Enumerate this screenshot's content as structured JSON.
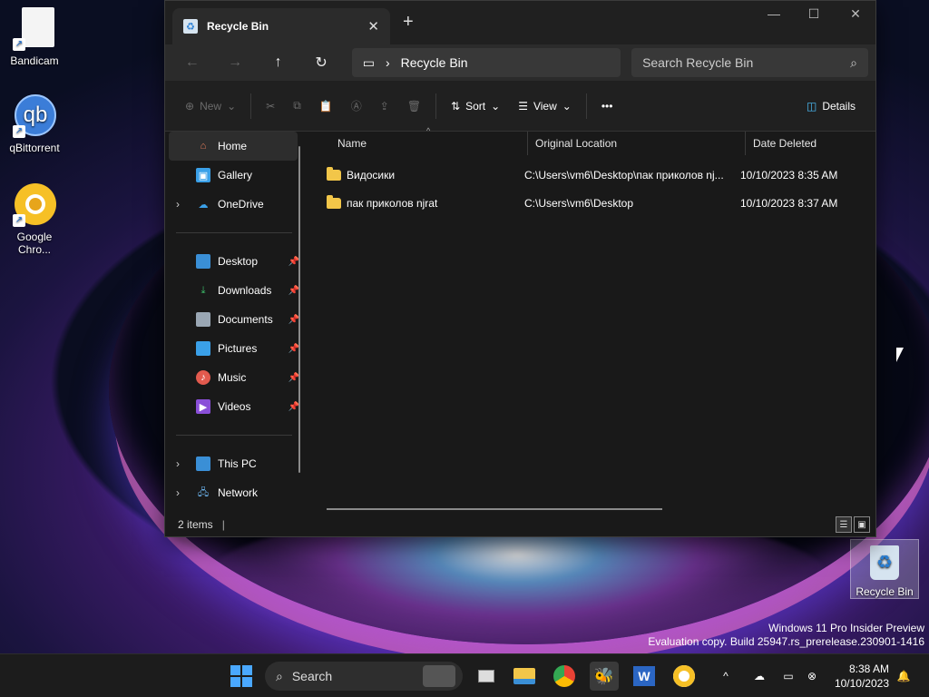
{
  "desktop": {
    "icons": [
      {
        "label": "Bandicam"
      },
      {
        "label": "qBittorrent"
      },
      {
        "label": "Google Chro..."
      },
      {
        "label": "Recycle Bin"
      }
    ],
    "watermark": {
      "line1": "Windows 11 Pro Insider Preview",
      "line2": "Evaluation copy. Build 25947.rs_prerelease.230901-1416"
    }
  },
  "window": {
    "tab_title": "Recycle Bin",
    "address": "Recycle Bin",
    "search_placeholder": "Search Recycle Bin",
    "toolbar": {
      "new_label": "New",
      "sort_label": "Sort",
      "view_label": "View",
      "more_label": "•••",
      "details_label": "Details"
    },
    "nav": {
      "home": "Home",
      "gallery": "Gallery",
      "onedrive": "OneDrive",
      "desktop": "Desktop",
      "downloads": "Downloads",
      "documents": "Documents",
      "pictures": "Pictures",
      "music": "Music",
      "videos": "Videos",
      "this_pc": "This PC",
      "network": "Network"
    },
    "columns": {
      "name": "Name",
      "original_location": "Original Location",
      "date_deleted": "Date Deleted"
    },
    "files": [
      {
        "name": "Видосики",
        "location": "C:\\Users\\vm6\\Desktop\\пак приколов nj...",
        "date": "10/10/2023 8:35 AM"
      },
      {
        "name": "пак приколов njrat",
        "location": "C:\\Users\\vm6\\Desktop",
        "date": "10/10/2023 8:37 AM"
      }
    ],
    "status": "2 items"
  },
  "taskbar": {
    "search_label": "Search",
    "time": "8:38 AM",
    "date": "10/10/2023"
  },
  "colors": {
    "accent": "#4cc2ff",
    "folder": "#f2c649",
    "start": "#4aa8ff"
  }
}
